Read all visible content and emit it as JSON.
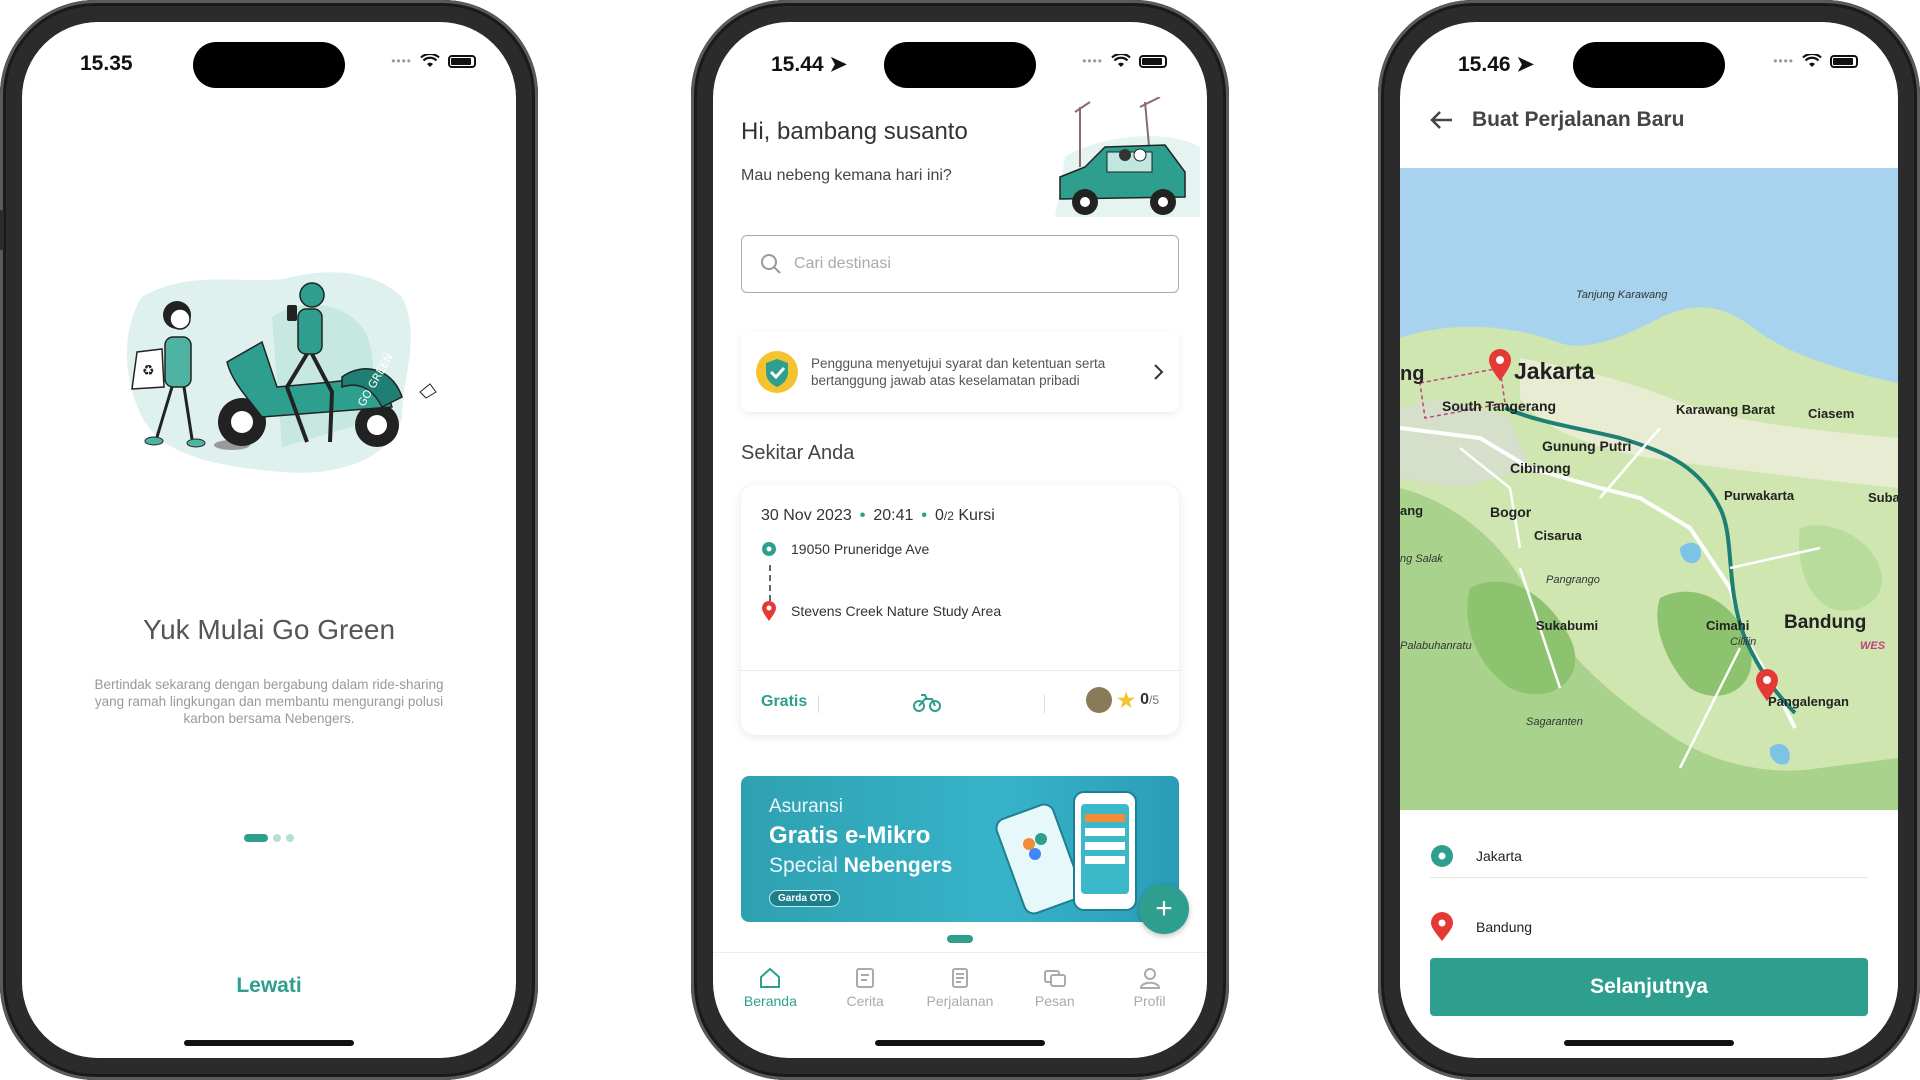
{
  "phone1": {
    "status_time": "15.35",
    "title": "Yuk Mulai Go Green",
    "description": "Bertindak sekarang dengan bergabung dalam ride-sharing yang ramah lingkungan dan membantu mengurangi polusi karbon bersama Nebengers.",
    "skip_label": "Lewati",
    "illustration_text": "GO GREEN"
  },
  "phone2": {
    "status_time": "15.44",
    "greeting": "Hi, bambang susanto",
    "subtitle": "Mau nebeng kemana hari ini?",
    "search_placeholder": "Cari destinasi",
    "notice": "Pengguna menyetujui syarat dan ketentuan serta bertanggung jawab atas keselamatan pribadi",
    "section_title": "Sekitar Anda",
    "trip": {
      "date": "30 Nov 2023",
      "time": "20:41",
      "seats_taken": "0",
      "seats_total": "/2",
      "seats_label": "Kursi",
      "origin": "19050 Pruneridge Ave",
      "destination": "Stevens Creek Nature Study Area",
      "price": "Gratis",
      "rating": "0",
      "rating_max": "/5"
    },
    "banner": {
      "line1": "Asuransi",
      "line2": "Gratis e-Mikro",
      "line3_prefix": "Special",
      "line3_bold": "Nebengers",
      "badge": "Garda OTO"
    },
    "tabs": [
      {
        "label": "Beranda",
        "icon": "home-icon",
        "active": true
      },
      {
        "label": "Cerita",
        "icon": "story-icon",
        "active": false
      },
      {
        "label": "Perjalanan",
        "icon": "trip-icon",
        "active": false
      },
      {
        "label": "Pesan",
        "icon": "chat-icon",
        "active": false
      },
      {
        "label": "Profil",
        "icon": "profile-icon",
        "active": false
      }
    ]
  },
  "phone3": {
    "status_time": "15.46",
    "title": "Buat Perjalanan Baru",
    "map_labels": {
      "tanjung": "Tanjung Karawang",
      "jakarta": "Jakarta",
      "south_tangerang": "South Tangerang",
      "karawang_barat": "Karawang Barat",
      "ciasem": "Ciasem",
      "gunung_putri": "Gunung Putri",
      "cibinong": "Cibinong",
      "purwakarta": "Purwakarta",
      "subang": "Subar",
      "bogor": "Bogor",
      "cisarua": "Cisarua",
      "salak": "ng Salak",
      "pangrango": "Pangrango",
      "sukabumi": "Sukabumi",
      "cimahi": "Cimahi",
      "bandung": "Bandung",
      "cililin": "Cililin",
      "palabuhanratu": "Palabuhanratu",
      "sagaranten": "Sagaranten",
      "pangalengan": "Pangalengan",
      "wes": "WES",
      "ng_left": "ng",
      "ang_left": "ang"
    },
    "origin": "Jakarta",
    "destination": "Bandung",
    "next_label": "Selanjutnya"
  },
  "colors": {
    "accent": "#2e9e8f",
    "pin_red": "#e53935"
  }
}
